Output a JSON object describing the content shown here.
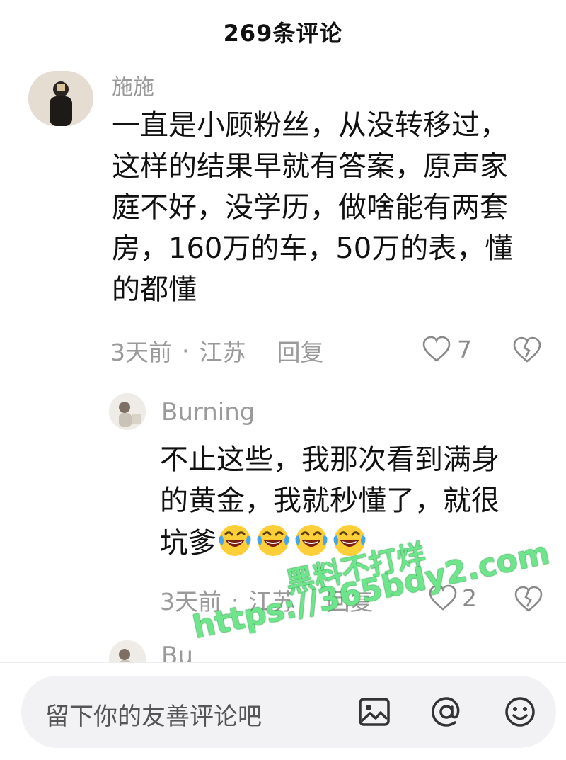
{
  "header": {
    "title": "269条评论"
  },
  "comments": [
    {
      "username": "施施",
      "lines": [
        "一直是小顾粉丝，从没转移过，",
        "这样的结果早就有答案，原声家",
        "庭不好，没学历，做啥能有两套",
        "房，160万的车，50万的表，懂",
        "的都懂"
      ],
      "time": "3天前",
      "location": "江苏",
      "reply_label": "回复",
      "likes": "7"
    },
    {
      "username": "Burning",
      "lines": [
        "不止这些，我那次看到满身",
        "的黄金，我就秒懂了，就很"
      ],
      "last_line": "坑爹",
      "emoji_count": 4,
      "emoji_name": "laughing-crying-emoji",
      "time": "3天前",
      "location": "江苏",
      "reply_label": "回复",
      "likes": "2"
    },
    {
      "username": "Bu"
    }
  ],
  "meta_separator": "·",
  "watermark": {
    "line1": "黑料不打烊",
    "line2": "https://365bdy2.com"
  },
  "bottom_bar": {
    "placeholder": "留下你的友善评论吧",
    "icons": [
      "image-icon",
      "at-icon",
      "emoji-icon"
    ]
  },
  "colors": {
    "meta_gray": "#9a9a9a",
    "watermark_green": "#6ee58a",
    "input_bg": "#f2f2f4"
  }
}
